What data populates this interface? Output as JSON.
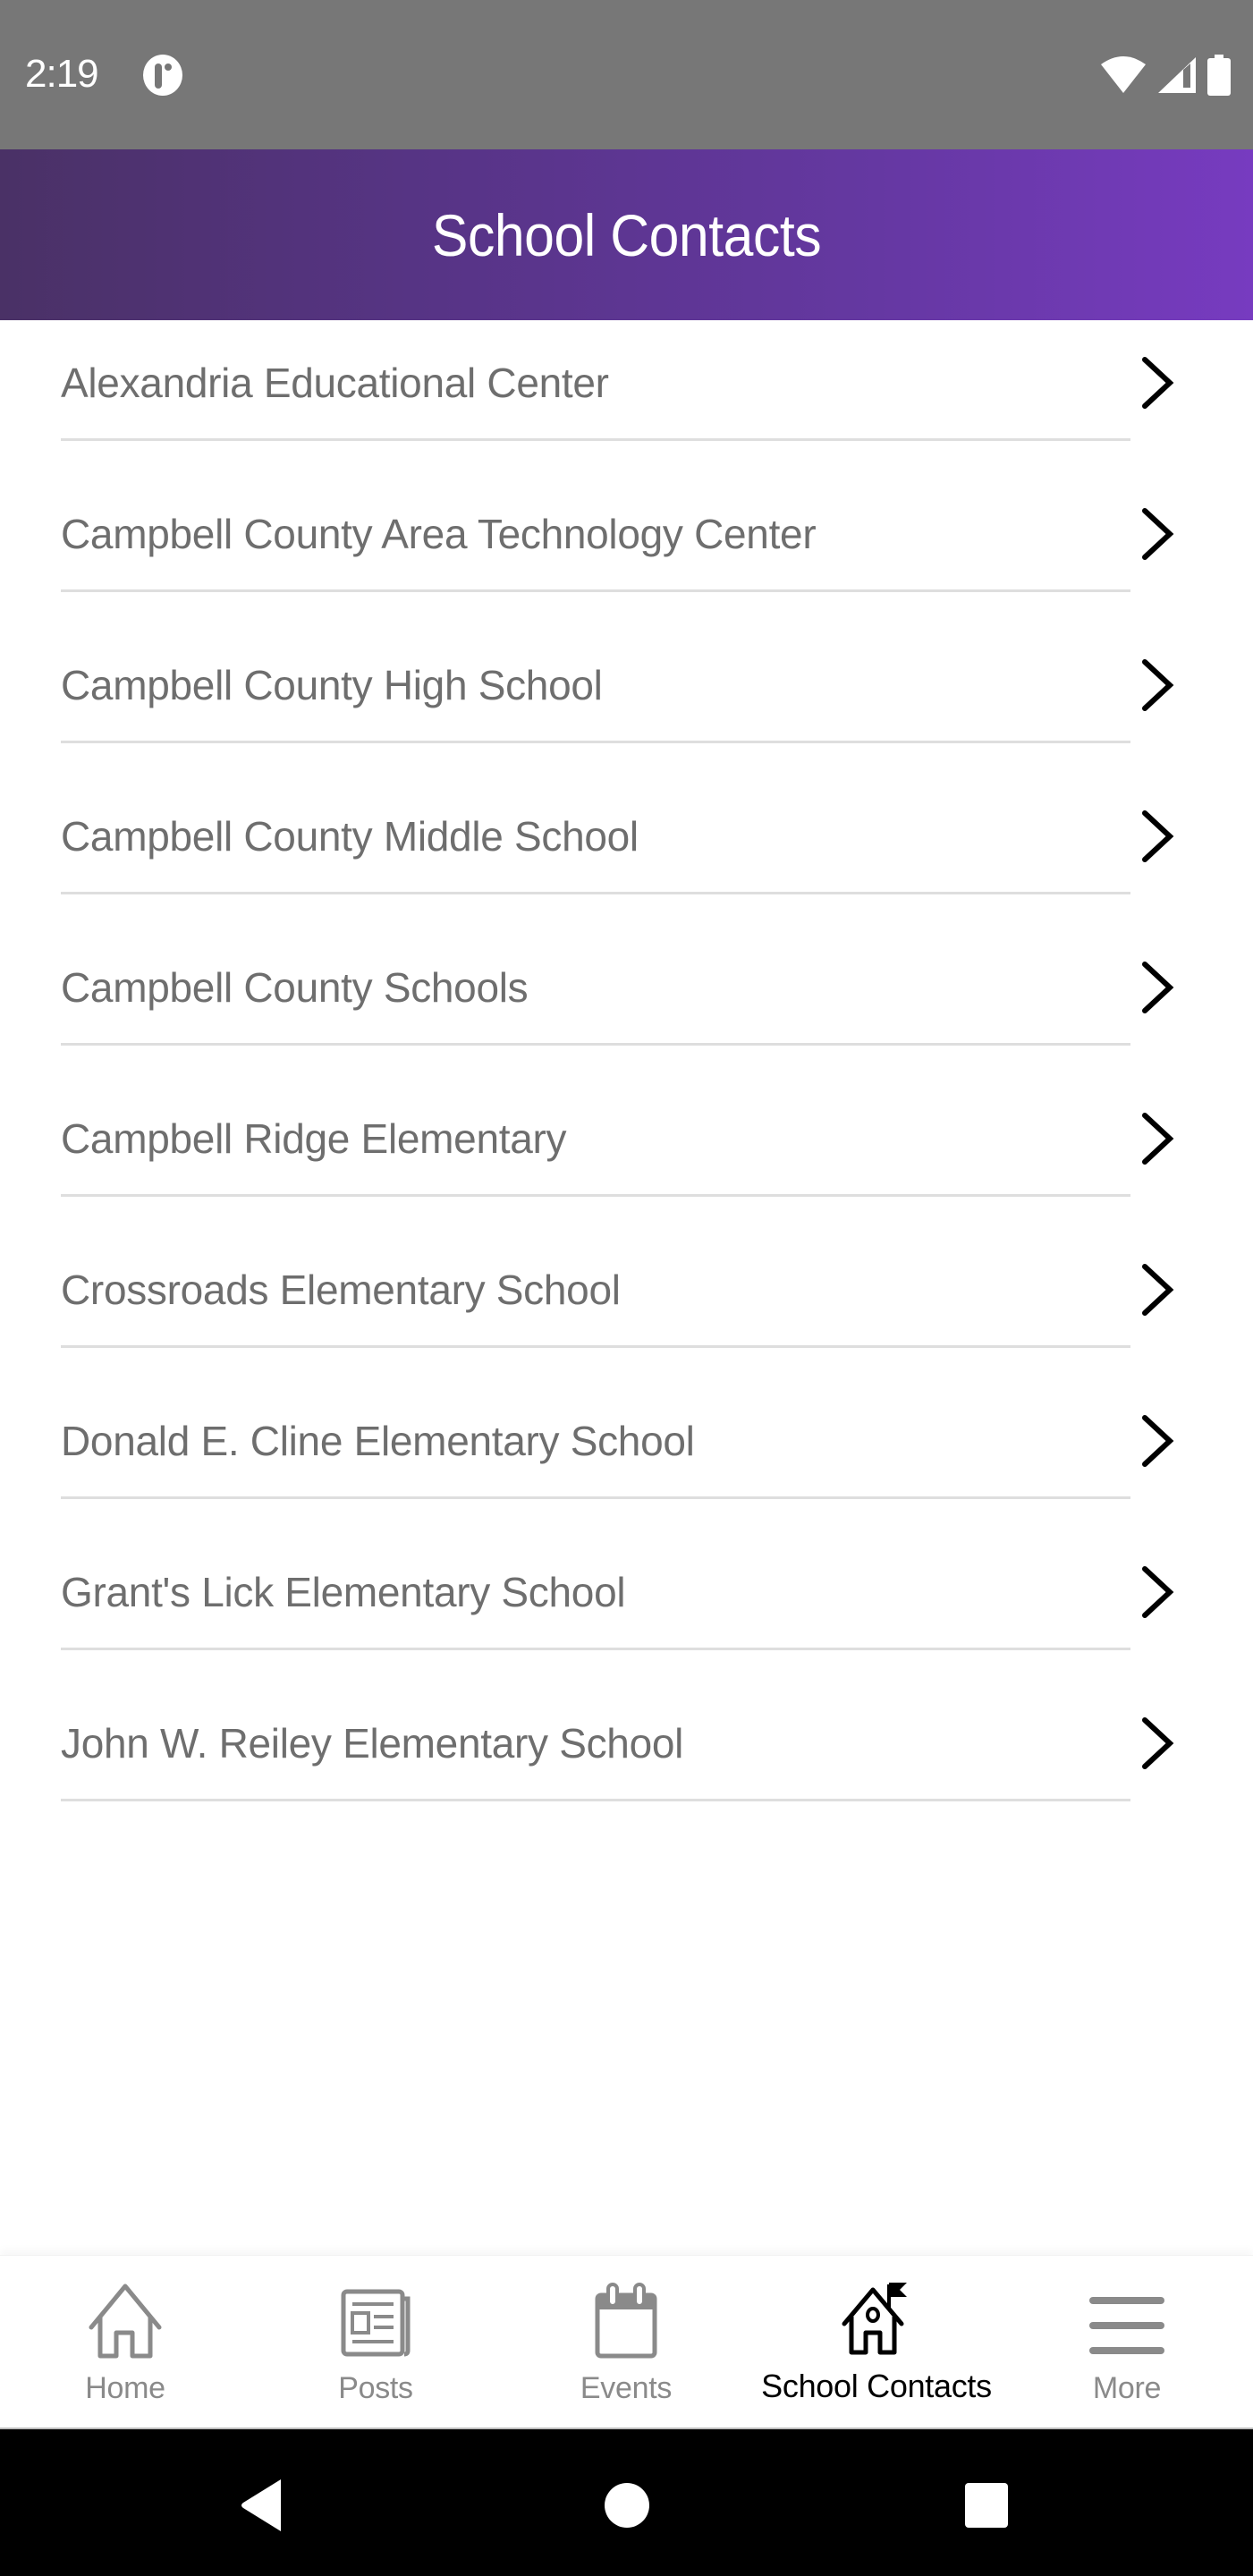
{
  "status_bar": {
    "time": "2:19",
    "icons": [
      "app-notification-icon",
      "wifi-icon",
      "cell-signal-icon",
      "battery-icon"
    ]
  },
  "header": {
    "title": "School Contacts",
    "gradient_colors": [
      "#4a3166",
      "#773bc0"
    ]
  },
  "contacts": [
    {
      "name": "Alexandria Educational Center"
    },
    {
      "name": "Campbell County Area Technology Center"
    },
    {
      "name": "Campbell County High School"
    },
    {
      "name": "Campbell County Middle School"
    },
    {
      "name": "Campbell County Schools"
    },
    {
      "name": "Campbell Ridge Elementary"
    },
    {
      "name": "Crossroads Elementary School"
    },
    {
      "name": "Donald E. Cline Elementary School"
    },
    {
      "name": "Grant's Lick Elementary School"
    },
    {
      "name": "John W. Reiley Elementary School"
    }
  ],
  "bottom_nav": {
    "items": [
      {
        "label": "Home",
        "icon": "home-icon",
        "active": false
      },
      {
        "label": "Posts",
        "icon": "newspaper-icon",
        "active": false
      },
      {
        "label": "Events",
        "icon": "calendar-icon",
        "active": false
      },
      {
        "label": "School Contacts",
        "icon": "school-flag-icon",
        "active": true
      },
      {
        "label": "More",
        "icon": "menu-icon",
        "active": false
      }
    ],
    "active_color": "#000000",
    "inactive_color": "#8a8a8a"
  },
  "system_nav": {
    "buttons": [
      "back",
      "home",
      "recents"
    ]
  }
}
